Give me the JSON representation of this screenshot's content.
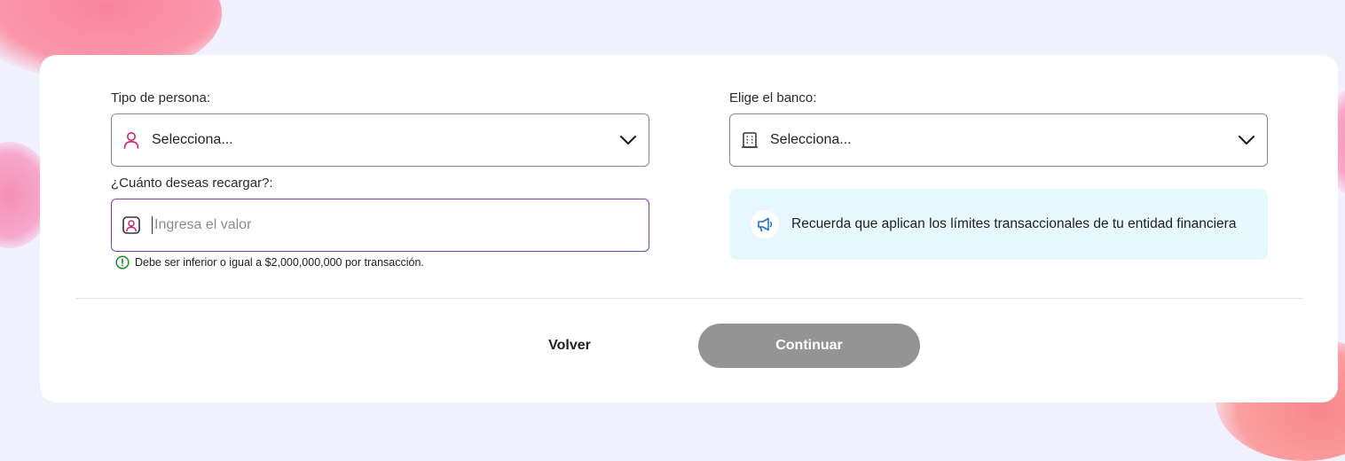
{
  "form": {
    "person_type": {
      "label": "Tipo de persona:",
      "value": "Selecciona..."
    },
    "bank": {
      "label": "Elige el banco:",
      "value": "Selecciona..."
    },
    "amount": {
      "label": "¿Cuánto deseas recargar?:",
      "placeholder": "Ingresa el valor",
      "hint": "Debe ser inferior o igual a $2,000,000,000 por transacción."
    },
    "notice": {
      "text": "Recuerda que aplican los límites transaccionales de tu entidad financiera"
    }
  },
  "actions": {
    "back_label": "Volver",
    "continue_label": "Continuar"
  },
  "icons": {
    "person": "user-icon",
    "bank": "bank-building-icon",
    "amount": "user-badge-icon",
    "hint": "info-circle-icon",
    "notice": "megaphone-icon",
    "dropdown": "chevron-down-icon"
  },
  "colors": {
    "accent_pink": "#d3236e",
    "input_focus_border": "#7a3fa3",
    "hint_green": "#1e8a2f",
    "notice_bg": "#e6f8fc",
    "notice_icon_blue": "#1f6fd6",
    "continue_disabled": "#949494"
  }
}
